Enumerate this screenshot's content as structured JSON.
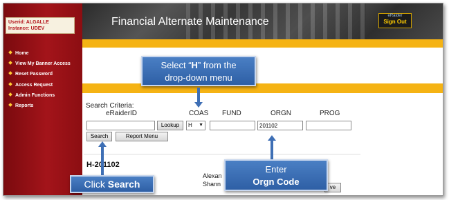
{
  "session": {
    "userid_label": "Userid: ALGALLE",
    "instance_label": "Instance: UDEV"
  },
  "nav": {
    "items": [
      {
        "label": "Home"
      },
      {
        "label": "View My Banner Access"
      },
      {
        "label": "Reset Password"
      },
      {
        "label": "Access Request"
      },
      {
        "label": "Admin Functions"
      },
      {
        "label": "Reports"
      }
    ]
  },
  "header": {
    "title": "Financial Alternate Maintenance",
    "signout_top": "eRaider",
    "signout_label": "Sign Out"
  },
  "search": {
    "criteria_label": "Search Criteria:",
    "columns": {
      "eraiderid": "eRaiderID",
      "coas": "COAS",
      "fund": "FUND",
      "orgn": "ORGN",
      "prog": "PROG"
    },
    "eraiderid_value": "",
    "lookup_label": "Lookup",
    "coas_value": "H",
    "fund_value": "",
    "orgn_value": "201102",
    "prog_value": "",
    "search_label": "Search",
    "report_menu_label": "Report Menu"
  },
  "result": {
    "heading": "H-201102",
    "name1": "Alexan",
    "name2": "Shann",
    "partial_button": "ve"
  },
  "callouts": {
    "coas_pre": "Select “",
    "coas_bold": "H",
    "coas_post": "” from the",
    "coas_line2": "drop-down menu",
    "orgn_line1": "Enter",
    "orgn_line2": "Orgn Code",
    "search_pre": "Click ",
    "search_bold": "Search"
  },
  "colors": {
    "sidebar": "#a3141a",
    "accent_bar": "#f5b314",
    "callout": "#3e6fb5"
  }
}
